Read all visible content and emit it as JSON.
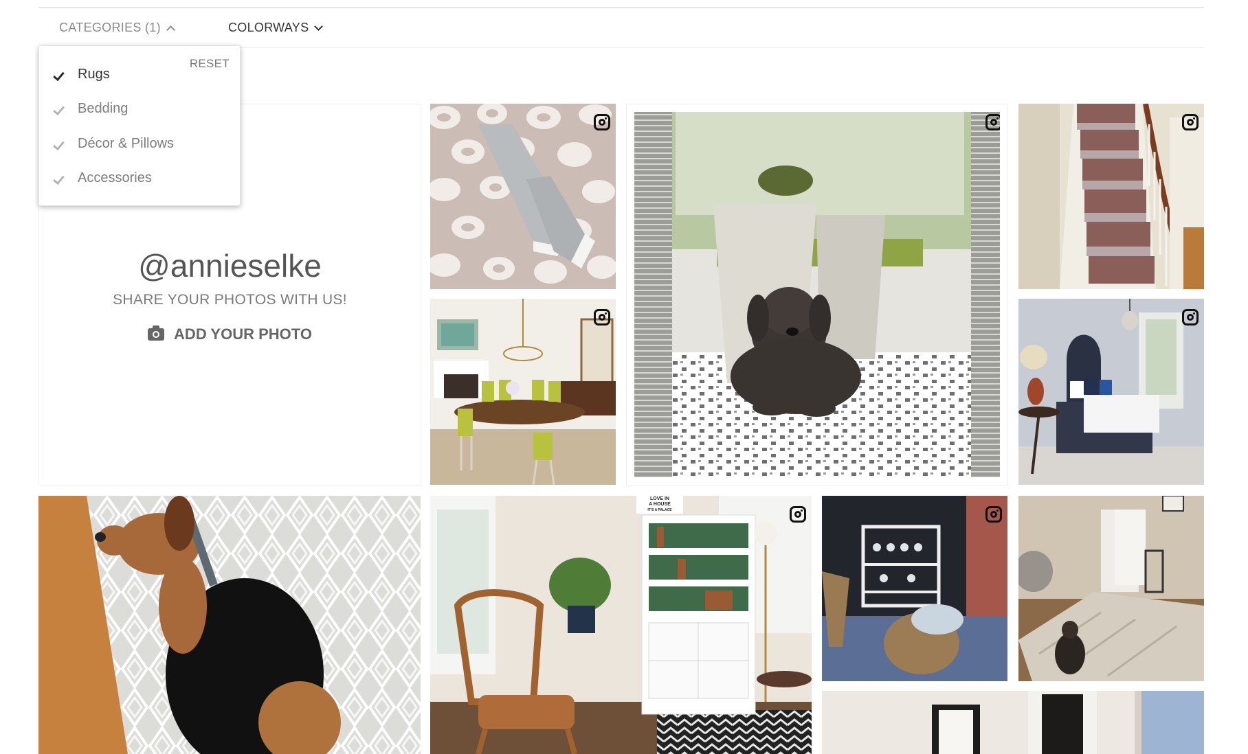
{
  "filters": {
    "categories_label": "CATEGORIES (1)",
    "colorways_label": "COLORWAYS",
    "reset_label": "RESET",
    "items": [
      {
        "label": "Rugs",
        "checked": true
      },
      {
        "label": "Bedding",
        "checked": false
      },
      {
        "label": "Décor & Pillows",
        "checked": false
      },
      {
        "label": "Accessories",
        "checked": false
      }
    ]
  },
  "promo": {
    "handle": "@annieselke",
    "share_text": "SHARE YOUR PHOTOS WITH US!",
    "add_photo_label": "ADD YOUR PHOTO"
  },
  "book_sign": {
    "line1": "LOVE IN",
    "line2": "A HOUSE",
    "line3": "IT'S A PALACE"
  },
  "photos": [
    {
      "name": "leopard-rug-sneakers"
    },
    {
      "name": "dining-room-rug"
    },
    {
      "name": "dog-on-patterned-rug"
    },
    {
      "name": "stair-runner"
    },
    {
      "name": "bedroom-rug"
    },
    {
      "name": "beagle-on-diamond-rug"
    },
    {
      "name": "living-room-bookcase"
    },
    {
      "name": "bar-cart-blue-rug"
    },
    {
      "name": "dog-on-area-rug"
    },
    {
      "name": "hallway"
    }
  ],
  "colors": {
    "accent_text": "#333333",
    "muted_text": "#8a8a8a",
    "instagram_icon": "#111111"
  }
}
